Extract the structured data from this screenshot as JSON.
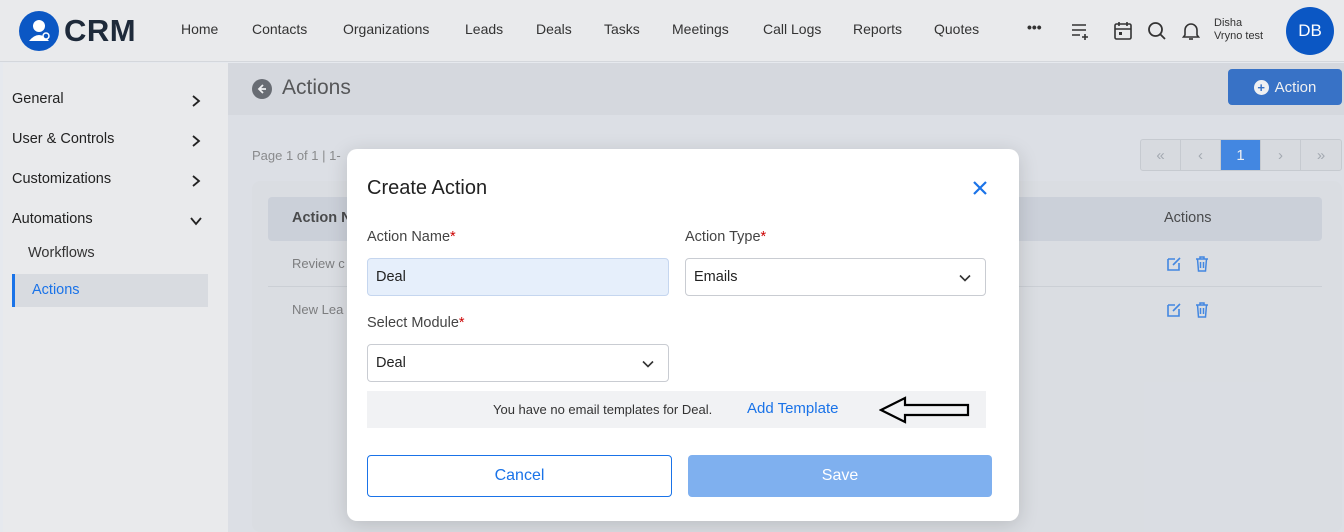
{
  "app": {
    "logo_text": "CRM"
  },
  "nav": {
    "items": [
      "Home",
      "Contacts",
      "Organizations",
      "Leads",
      "Deals",
      "Tasks",
      "Meetings",
      "Call Logs",
      "Reports",
      "Quotes"
    ],
    "more_label": "•••"
  },
  "user": {
    "name_line1": "Disha",
    "name_line2": "Vryno test",
    "initials": "DB"
  },
  "sidebar": {
    "items": [
      {
        "label": "General"
      },
      {
        "label": "User & Controls"
      },
      {
        "label": "Customizations"
      },
      {
        "label": "Automations"
      }
    ],
    "sub_items": [
      {
        "label": "Workflows"
      },
      {
        "label": "Actions"
      }
    ]
  },
  "page": {
    "title": "Actions",
    "action_button_label": "Action",
    "page_info": "Page 1 of 1  |  1-",
    "pager": {
      "first": "«",
      "prev": "‹",
      "current": "1",
      "next": "›",
      "last": "»"
    }
  },
  "table": {
    "header_name": "Action N",
    "header_actions": "Actions",
    "rows": [
      {
        "name": "Review c"
      },
      {
        "name": "New Lea"
      }
    ]
  },
  "modal": {
    "title": "Create Action",
    "action_name_label": "Action Name",
    "action_name_value": "Deal",
    "action_type_label": "Action Type",
    "action_type_value": "Emails",
    "module_label": "Select Module",
    "module_value": "Deal",
    "required_mark": "*",
    "notice_text": "You have no email templates for Deal.",
    "notice_link": "Add Template",
    "cancel_label": "Cancel",
    "save_label": "Save"
  },
  "colors": {
    "accent": "#1a73e8",
    "brand": "#0b57c4",
    "save_disabled": "#7fb0ef"
  }
}
